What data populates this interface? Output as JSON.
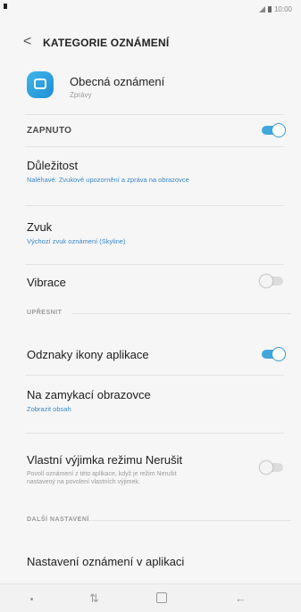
{
  "status": {
    "time": "10:00"
  },
  "appbar": {
    "title": "KATEGORIE OZNÁMENÍ",
    "back_icon": "chevron-left-icon"
  },
  "app": {
    "name": "Obecná oznámení",
    "subtitle": "Zprávy",
    "icon": "message-bubble-icon"
  },
  "main_switch": {
    "label": "ZAPNUTO",
    "on": true
  },
  "rows": {
    "importance": {
      "title": "Důležitost",
      "subtitle": "Naléhavé: Zvukové upozornění a zpráva na obrazovce"
    },
    "sound": {
      "title": "Zvuk",
      "subtitle": "Výchozí zvuk oznámení (Skyline)"
    },
    "vibration": {
      "title": "Vibrace",
      "on": false
    },
    "badges": {
      "title": "Odznaky ikony aplikace",
      "on": true
    },
    "lockscreen": {
      "title": "Na zamykací obrazovce",
      "subtitle": "Zobrazit obsah"
    },
    "dnd": {
      "title": "Vlastní výjimka režimu Nerušit",
      "description": "Povolí oznámení z této aplikace, když je režim Nerušit nastavený na povolení vlastních výjimek.",
      "on": false
    },
    "app_settings": {
      "title": "Nastavení oznámení v aplikaci"
    }
  },
  "sections": {
    "refine": "UPŘESNIT",
    "more": "DALŠÍ NASTAVENÍ"
  },
  "navbar": {
    "recents_icon": "recent-apps-icon",
    "home_icon": "home-icon",
    "back_icon": "back-arrow-icon"
  },
  "colors": {
    "accent": "#41a8dd",
    "link": "#3a88c7"
  }
}
